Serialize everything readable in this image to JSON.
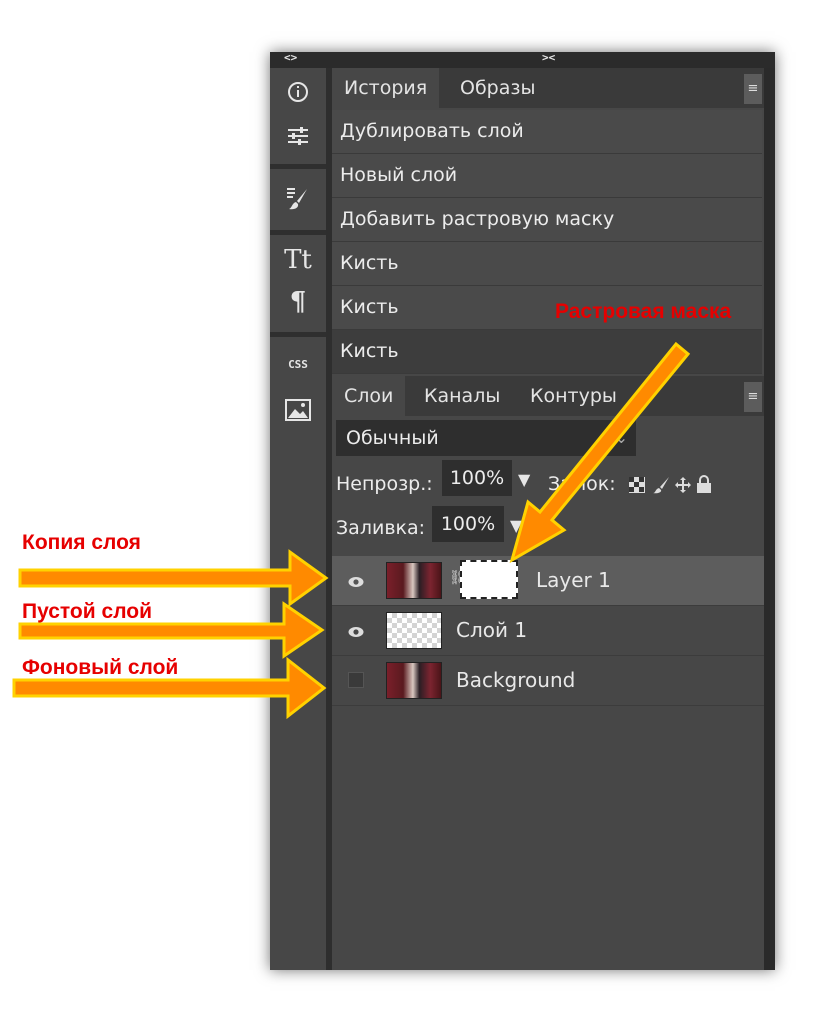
{
  "topbar": {
    "left_toggle": "<>",
    "center_toggle": "><"
  },
  "toolbar": {
    "items": [
      "info-icon",
      "adjust-icon",
      "brush-icon",
      "text-icon",
      "paragraph-icon",
      "css-icon",
      "image-icon"
    ],
    "css_label": "CSS",
    "text_glyph": "Tt",
    "paragraph_glyph": "¶"
  },
  "history_panel": {
    "tabs": [
      {
        "label": "История",
        "active": true
      },
      {
        "label": "Образы",
        "active": false
      }
    ],
    "menu_glyph": "≡",
    "items": [
      "Дублировать слой",
      "Новый слой",
      "Добавить растровую маску",
      "Кисть",
      "Кисть",
      "Кисть"
    ]
  },
  "layers_panel": {
    "tabs": [
      {
        "label": "Слои",
        "active": true
      },
      {
        "label": "Каналы",
        "active": false
      },
      {
        "label": "Контуры",
        "active": false
      }
    ],
    "menu_glyph": "≡",
    "blend_mode": "Обычный",
    "opacity_label": "Непрозр.:",
    "opacity_value": "100%",
    "lock_label": "Замок:",
    "fill_label": "Заливка:",
    "fill_value": "100%",
    "layers": [
      {
        "name": "Layer 1",
        "visible": true,
        "thumb": "photo",
        "has_mask": true,
        "selected": true
      },
      {
        "name": "Слой 1",
        "visible": true,
        "thumb": "transparent",
        "has_mask": false,
        "selected": false
      },
      {
        "name": "Background",
        "visible": false,
        "thumb": "photo",
        "has_mask": false,
        "selected": false
      }
    ]
  },
  "annotations": {
    "raster_mask": "Растровая маска",
    "layer_copy": "Копия слоя",
    "empty_layer": "Пустой слой",
    "background_layer": "Фоновый слой"
  },
  "colors": {
    "annotation_text": "#e60000",
    "arrow_fill": "#ff8a00",
    "arrow_outline": "#ffd200",
    "panel_bg": "#474747"
  }
}
